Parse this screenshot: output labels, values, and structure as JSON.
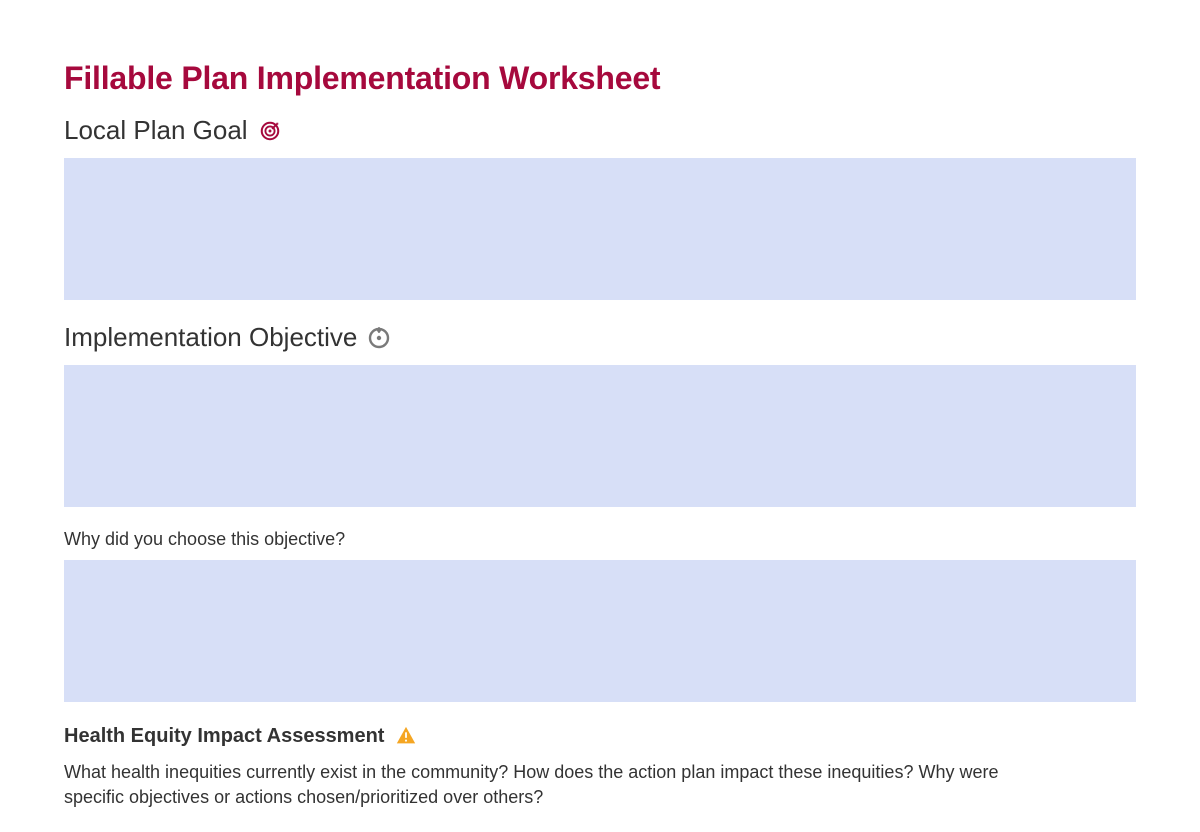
{
  "page": {
    "title": "Fillable Plan Implementation Worksheet"
  },
  "sections": {
    "goal": {
      "heading": "Local Plan Goal",
      "value": ""
    },
    "objective": {
      "heading": "Implementation Objective",
      "value": ""
    },
    "why": {
      "question": "Why did you choose this objective?",
      "value": ""
    },
    "equity": {
      "heading": "Health Equity Impact Assessment",
      "description": "What health inequities currently exist in the community? How does the action plan impact these inequities? Why were specific objectives or actions chosen/prioritized over others?"
    }
  },
  "colors": {
    "accent": "#a6093d",
    "fill": "#d7dff7",
    "warning": "#f5a623"
  }
}
